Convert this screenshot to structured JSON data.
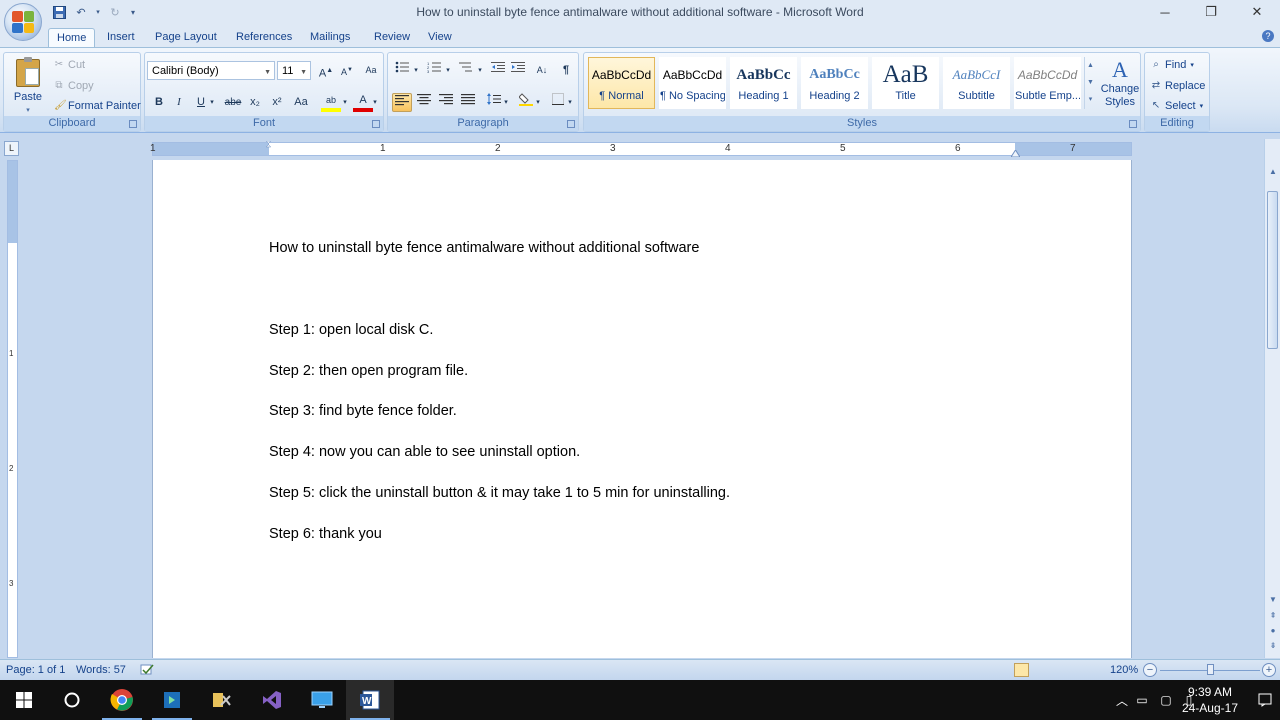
{
  "window": {
    "title": "How to uninstall byte fence antimalware without additional software - Microsoft Word",
    "minimize": "─",
    "maximize": "❐",
    "close": "✕"
  },
  "tabs": [
    "Home",
    "Insert",
    "Page Layout",
    "References",
    "Mailings",
    "Review",
    "View"
  ],
  "clipboard": {
    "paste": "Paste",
    "cut": "Cut",
    "copy": "Copy",
    "format_painter": "Format Painter",
    "label": "Clipboard"
  },
  "font": {
    "name": "Calibri (Body)",
    "size": "11",
    "label": "Font",
    "grow": "A",
    "shrink": "A",
    "clear": "Aa",
    "bold": "B",
    "italic": "I",
    "underline": "U",
    "strike": "abe",
    "subscript": "x₂",
    "superscript": "x²",
    "change_case": "Aa",
    "highlight": "ab",
    "font_color": "A"
  },
  "paragraph": {
    "label": "Paragraph",
    "show_marks": "¶",
    "sort": "A↓"
  },
  "styles": {
    "label": "Styles",
    "items": [
      {
        "sample": "AaBbCcDd",
        "name": "¶ Normal"
      },
      {
        "sample": "AaBbCcDd",
        "name": "¶ No Spacing"
      },
      {
        "sample": "AaBbCc",
        "name": "Heading 1"
      },
      {
        "sample": "AaBbCc",
        "name": "Heading 2"
      },
      {
        "sample": "AaB",
        "name": "Title"
      },
      {
        "sample": "AaBbCcI",
        "name": "Subtitle"
      },
      {
        "sample": "AaBbCcDd",
        "name": "Subtle Emp..."
      }
    ],
    "change_styles": "Change Styles",
    "change_icon": "A"
  },
  "editing": {
    "label": "Editing",
    "find": "Find",
    "replace": "Replace",
    "select": "Select"
  },
  "ruler": {
    "numbers": [
      "1",
      "1",
      "2",
      "3",
      "4",
      "5",
      "6",
      "7"
    ],
    "vnumbers": [
      "1",
      "2",
      "3"
    ]
  },
  "document": {
    "title_line": "How to uninstall byte fence antimalware without additional software",
    "steps": [
      "Step 1: open local disk C.",
      "Step 2: then open program file.",
      "Step 3: find byte fence folder.",
      "Step 4: now you can able to see uninstall option.",
      "Step 5: click the uninstall button & it may take 1 to 5 min for uninstalling.",
      "Step 6: thank you"
    ]
  },
  "status": {
    "page": "Page: 1 of 1",
    "words": "Words: 57",
    "zoom": "120%"
  },
  "taskbar": {
    "time": "9:39 AM",
    "date": "24-Aug-17"
  },
  "colors": {
    "ribbon_bg": "#dbe7f5",
    "doc_bg": "#c5d7ee",
    "highlight": "#ffff00",
    "font_color": "#e00000"
  }
}
